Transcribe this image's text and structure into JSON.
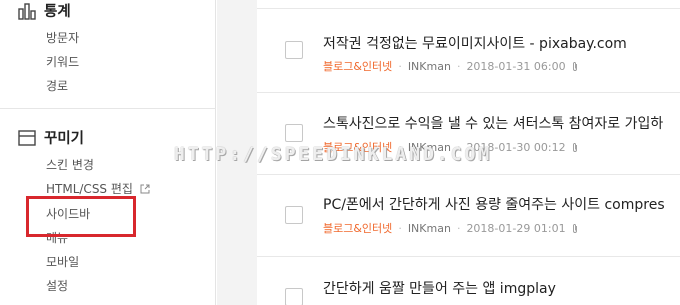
{
  "sidebar": {
    "stats": {
      "title": "통계",
      "items": [
        {
          "label": "방문자"
        },
        {
          "label": "키워드"
        },
        {
          "label": "경로"
        }
      ]
    },
    "decorate": {
      "title": "꾸미기",
      "items": [
        {
          "label": "스킨 변경"
        },
        {
          "label": "HTML/CSS 편집"
        },
        {
          "label": "사이드바"
        },
        {
          "label": "메뉴"
        },
        {
          "label": "모바일"
        },
        {
          "label": "설정"
        }
      ]
    },
    "highlight_color": "#d8272d"
  },
  "posts": [
    {
      "title": "저작권 걱정없는 무료이미지사이트 - pixabay.com",
      "category": "블로그&인터넷",
      "author": "INKman",
      "date": "2018-01-31 06:00",
      "has_attachment": true
    },
    {
      "title": "스톡사진으로 수익을 낼 수 있는 셔터스톡 참여자로 가입하",
      "category": "블로그&인터넷",
      "author": "INKman",
      "date": "2018-01-30 00:12",
      "has_attachment": true
    },
    {
      "title": "PC/폰에서 간단하게 사진 용량 줄여주는 사이트 compres",
      "category": "블로그&인터넷",
      "author": "INKman",
      "date": "2018-01-29 01:01",
      "has_attachment": true
    },
    {
      "title": "간단하게 움짤 만들어 주는 앱 imgplay",
      "category": "",
      "author": "",
      "date": "",
      "has_attachment": false
    }
  ],
  "watermark": "HTTP://SPEEDINKLAND.COM",
  "colors": {
    "category": "#f0682c",
    "accent_red": "#d8272d"
  }
}
